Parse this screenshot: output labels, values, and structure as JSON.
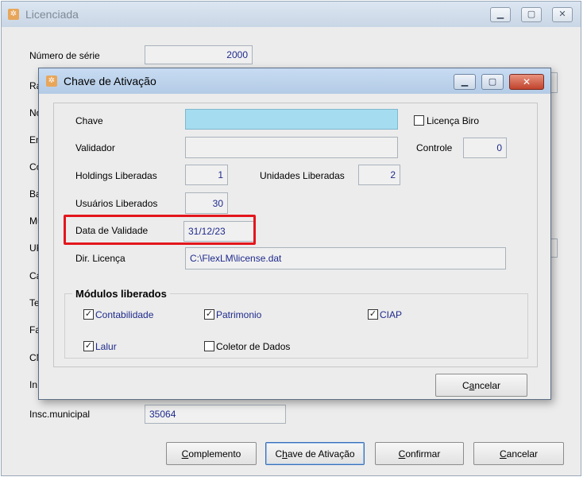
{
  "outer_window": {
    "title": "Licenciada",
    "title_icon": "app-icon",
    "caption_buttons": {
      "minimize": "▁",
      "maximize": "▢",
      "close": "✕"
    },
    "labels": {
      "serial": "Número de série",
      "r_partial": "Ra",
      "n_partial": "No",
      "e_partial": "En",
      "c1_partial": "Co",
      "b_partial": "Ba",
      "m_partial": "Mu",
      "uf_partial": "UF",
      "c2_partial": "Ca",
      "t_partial": "Te",
      "f_partial": "Fa",
      "cn_partial": "CN",
      "in_partial": "In",
      "insc_municipal": "Insc.municipal"
    },
    "values": {
      "serial": "2000",
      "insc_municipal": "35064"
    },
    "buttons": {
      "complemento": "Complemento",
      "chave": "Chave de Ativação",
      "confirmar": "Confirmar",
      "cancelar": "Cancelar"
    }
  },
  "dialog": {
    "title": "Chave de Ativação",
    "title_icon": "app-icon",
    "caption_buttons": {
      "minimize": "▁",
      "maximize": "▢",
      "close": "✕"
    },
    "labels": {
      "chave": "Chave",
      "validador": "Validador",
      "holdings": "Holdings Liberadas",
      "unidades": "Unidades Liberadas",
      "usuarios": "Usuários Liberados",
      "data_validade": "Data de Validade",
      "dir_licenca": "Dir. Licença",
      "controle": "Controle",
      "licenca_biro": "Licença Biro"
    },
    "values": {
      "chave": "",
      "validador": "",
      "holdings": "1",
      "unidades": "2",
      "usuarios": "30",
      "data_validade": "31/12/23",
      "dir_licenca": "C:\\FlexLM\\license.dat",
      "controle": "0"
    },
    "licenca_biro_checked": false,
    "modules": {
      "title": "Módulos liberados",
      "items": [
        {
          "label": "Contabilidade",
          "checked": true
        },
        {
          "label": "Patrimonio",
          "checked": true
        },
        {
          "label": "CIAP",
          "checked": true
        },
        {
          "label": "Lalur",
          "checked": true
        },
        {
          "label": "Coletor de Dados",
          "checked": false
        }
      ]
    },
    "cancel_button": "Cancelar"
  },
  "colors": {
    "highlight": "#e3161c",
    "active_field": "#a6dcef",
    "value_text": "#1e2a8c"
  }
}
